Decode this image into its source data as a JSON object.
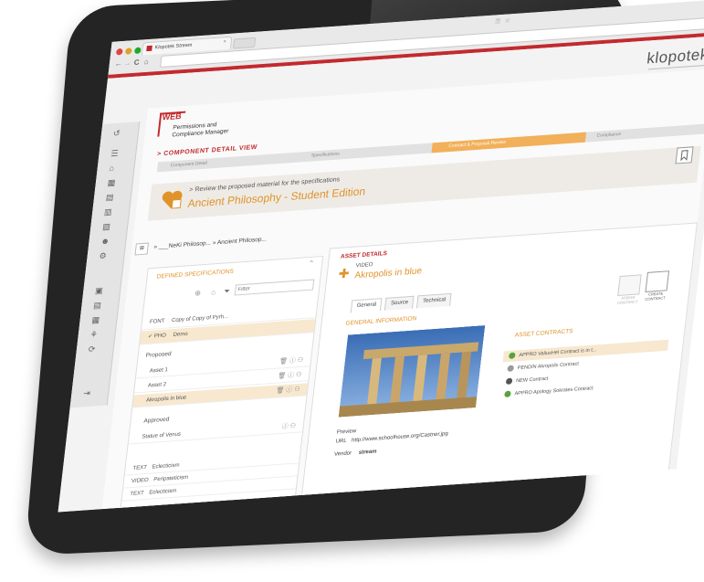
{
  "browser": {
    "tab_title": "Klopotek Stream",
    "tab_close": "×",
    "nav_back": "←",
    "nav_forward": "→",
    "nav_reload": "C",
    "nav_home": "⌂"
  },
  "app": {
    "brand": "klopotek.",
    "logo_web": "WEB",
    "logo_subtitle_1": "Permissions and",
    "logo_subtitle_2": "Compliance Manager",
    "view_title": "> COMPONENT DETAIL VIEW",
    "steps": [
      "Component Detail",
      "Specifications",
      "Contract & Proposal Review",
      "Compliance"
    ],
    "review_subtitle": "> Review the proposed material for the specifications",
    "review_title": "Ancient Philosophy - Student Edition",
    "breadcrumb": "» ___NeKi Philosop... » Ancient Philosop..."
  },
  "specs": {
    "header": "DEFINED SPECIFICATIONS",
    "filter_placeholder": "Filter",
    "rows": [
      {
        "type": "FONT",
        "label": "Copy of Copy of Pyrh..."
      },
      {
        "type": "PHO",
        "label": "Demo"
      }
    ],
    "proposed_label": "Proposed",
    "proposed": [
      "Asset 1",
      "Asset 2",
      "Akropolis in blue"
    ],
    "approved_label": "Approved",
    "approved": [
      "Statue of Venus"
    ],
    "bottom_rows": [
      {
        "type": "TEXT",
        "label": "Eclecticism"
      },
      {
        "type": "VIDEO",
        "label": "Peripateticism"
      },
      {
        "type": "TEXT",
        "label": "Eclecticism"
      }
    ]
  },
  "asset": {
    "header": "ASSET DETAILS",
    "kind": "VIDEO",
    "title": "Akropolis in blue",
    "tabs": [
      "General",
      "Source",
      "Technical"
    ],
    "general_header": "GENERAL INFORMATION",
    "preview_label": "Preview",
    "url_label": "URL",
    "url_value": "http://www.schoolhouse.org/Castner.jpg",
    "vendor_label": "Vendor",
    "vendor_value": "stream",
    "assign_contract": "ASSIGN CONTRACT",
    "create_contract": "CREATE CONTRACT",
    "contracts_header": "ASSET CONTRACTS",
    "contracts": [
      {
        "status": "APPRO",
        "label": "ValiusHel Contract is in t...",
        "color": "#5aa33c"
      },
      {
        "status": "PENDIN",
        "label": "Akropolis Contract",
        "color": "#999999"
      },
      {
        "status": "NEW",
        "label": "Contract",
        "color": "#555555"
      },
      {
        "status": "APPRO",
        "label": "Apology Sokrates Contract",
        "color": "#5aa33c"
      }
    ]
  },
  "colors": {
    "accent": "#c22a2e",
    "orange": "#e0932a"
  }
}
